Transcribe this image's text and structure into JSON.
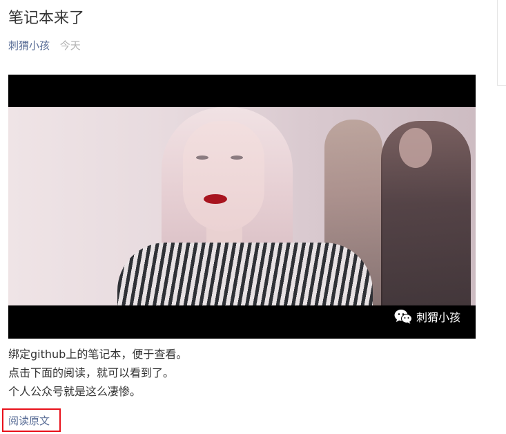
{
  "article": {
    "title": "笔记本来了",
    "author": "刺猬小孩",
    "date": "今天"
  },
  "cover": {
    "watermark_icon": "wechat-icon",
    "watermark_text": "刺猬小孩"
  },
  "content": {
    "paragraphs": [
      "绑定github上的笔记本，便于查看。",
      "点击下面的阅读，就可以看到了。",
      "个人公众号就是这么凄惨。"
    ]
  },
  "footer": {
    "read_original_label": "阅读原文",
    "highlight_color": "#e8101a"
  },
  "colors": {
    "link": "#576b95",
    "meta_gray": "#b2b2b2",
    "text": "#333333"
  }
}
